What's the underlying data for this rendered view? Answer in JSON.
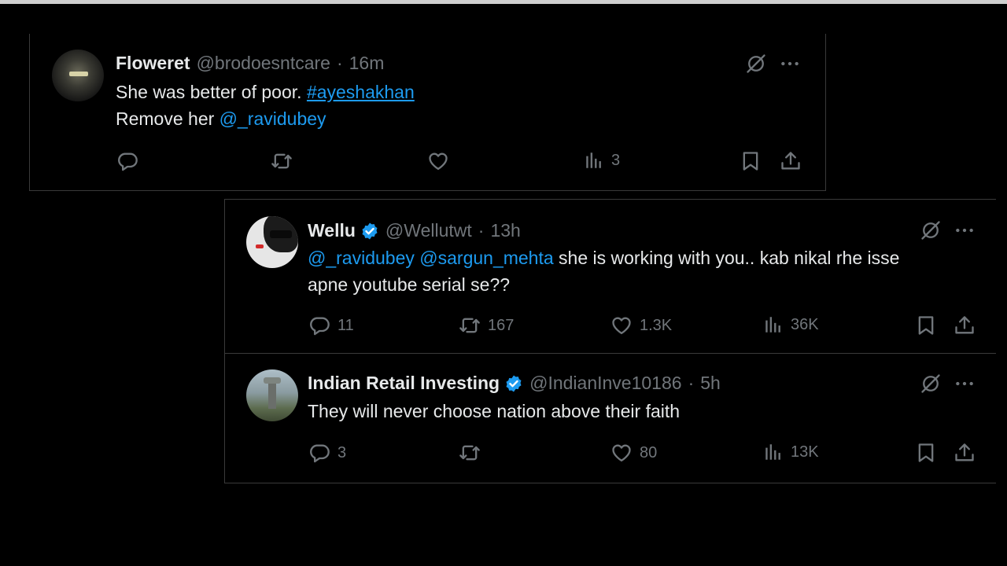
{
  "tweets": [
    {
      "name": "Floweret",
      "handle": "@brodoesntcare",
      "time": "16m",
      "line1_text": "She was better of poor.",
      "line1_tag": "#ayeshakhan",
      "line2_text": "Remove her",
      "line2_tag": "@_ravidubey",
      "replies": "",
      "reposts": "",
      "likes": "",
      "views": "3"
    },
    {
      "name": "Wellu",
      "handle": "@Wellutwt",
      "time": "13h",
      "verified": true,
      "mention1": "@_ravidubey",
      "mention2": "@sargun_mehta",
      "text1": "she is working with you.. kab nikal rhe isse",
      "text2": "apne youtube serial se??",
      "replies": "11",
      "reposts": "167",
      "likes": "1.3K",
      "views": "36K"
    },
    {
      "name": "Indian Retail Investing",
      "handle": "@IndianInve10186",
      "time": "5h",
      "verified": true,
      "text": "They will never choose nation above their faith",
      "replies": "3",
      "reposts": "",
      "likes": "80",
      "views": "13K"
    }
  ],
  "separator": "·",
  "icons": [
    "grok-icon",
    "more-icon",
    "reply-icon",
    "repost-icon",
    "like-icon",
    "views-icon",
    "bookmark-icon",
    "share-icon",
    "verified-badge-icon"
  ],
  "colors": {
    "background": "#000000",
    "text": "#e7e9ea",
    "muted": "#71767b",
    "link": "#1d9bf0",
    "border": "#3a3a3a"
  }
}
